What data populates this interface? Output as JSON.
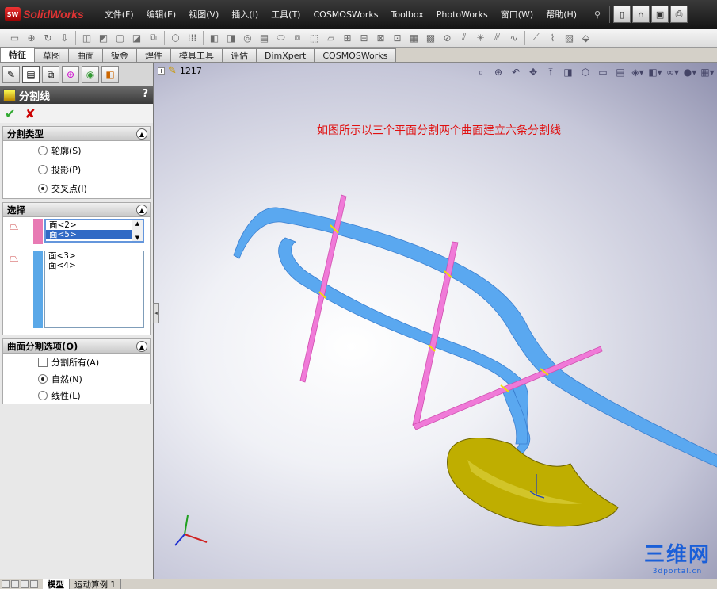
{
  "app": {
    "logo_badge": "SW",
    "logo_text": "SolidWorks"
  },
  "menu": [
    "文件(F)",
    "编辑(E)",
    "视图(V)",
    "插入(I)",
    "工具(T)",
    "COSMOSWorks",
    "Toolbox",
    "PhotoWorks",
    "窗口(W)",
    "帮助(H)"
  ],
  "command_tabs": [
    "特征",
    "草图",
    "曲面",
    "钣金",
    "焊件",
    "模具工具",
    "评估",
    "DimXpert",
    "COSMOSWorks"
  ],
  "property_manager": {
    "title": "分割线",
    "help": "?",
    "ok": "✔",
    "cancel": "✘",
    "split_type": {
      "title": "分割类型",
      "options": [
        "轮廓(S)",
        "投影(P)",
        "交叉点(I)"
      ],
      "selected": "交叉点(I)"
    },
    "selection": {
      "title": "选择",
      "list1": [
        "面<2>",
        "面<5>"
      ],
      "list1_selected": "面<5>",
      "list1_color": "#e87ab4",
      "list2": [
        "面<3>",
        "面<4>"
      ],
      "list2_color": "#5aa8e8"
    },
    "surface_options": {
      "title": "曲面分割选项(O)",
      "split_all": "分割所有(A)",
      "natural": "自然(N)",
      "linear": "线性(L)",
      "selected": "自然(N)"
    }
  },
  "tree": {
    "item_label": "1217"
  },
  "annotation": "如图所示以三个平面分割两个曲面建立六条分割线",
  "bottom_tabs": [
    "模型",
    "运动算例 1"
  ],
  "watermark": {
    "text": "三维网",
    "sub": "3dportal.cn"
  },
  "colors": {
    "blue_surface": "#5aa8f0",
    "pink_plane": "#f07ad8",
    "part_yellow": "#c8b400"
  }
}
